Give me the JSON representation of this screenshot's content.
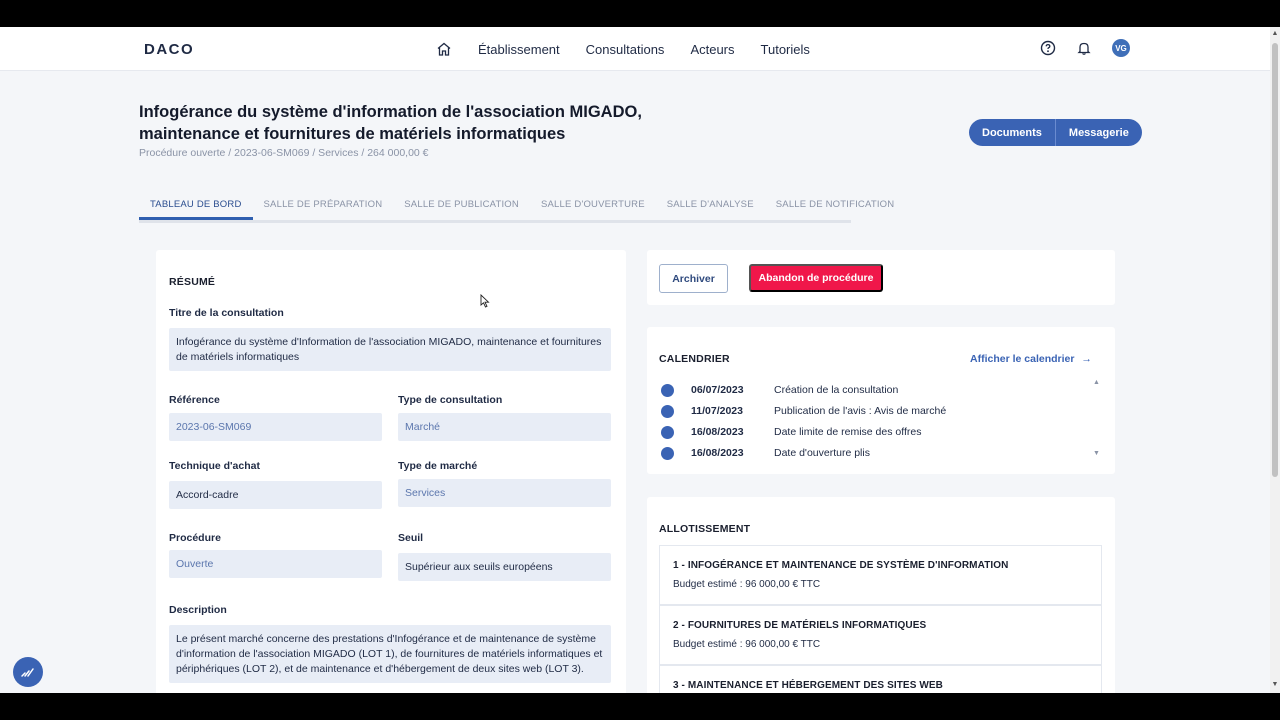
{
  "header": {
    "logo": "DACO",
    "nav": [
      "Établissement",
      "Consultations",
      "Acteurs",
      "Tutoriels"
    ],
    "avatar_initials": "VG"
  },
  "page": {
    "title": "Infogérance du système d'information de l'association MIGADO, maintenance et fournitures de matériels informatiques",
    "subtitle": "Procédure ouverte / 2023-06-SM069 / Services / 264 000,00 €",
    "documents_label": "Documents",
    "messagerie_label": "Messagerie"
  },
  "tabs": [
    "TABLEAU DE BORD",
    "SALLE DE PRÉPARATION",
    "SALLE DE PUBLICATION",
    "SALLE D'OUVERTURE",
    "SALLE D'ANALYSE",
    "SALLE DE NOTIFICATION"
  ],
  "resume": {
    "section_title": "RÉSUMÉ",
    "titre_label": "Titre de la consultation",
    "titre_value": "Infogérance du système d'Information de l'association MIGADO, maintenance et fournitures de matériels informatiques",
    "reference_label": "Référence",
    "reference_value": "2023-06-SM069",
    "type_consultation_label": "Type de consultation",
    "type_consultation_value": "Marché",
    "technique_label": "Technique d'achat",
    "technique_value": "Accord-cadre",
    "type_marche_label": "Type de marché",
    "type_marche_value": "Services",
    "procedure_label": "Procédure",
    "procedure_value": "Ouverte",
    "seuil_label": "Seuil",
    "seuil_value": "Supérieur aux seuils européens",
    "description_label": "Description",
    "description_value": "Le présent marché concerne des prestations d'Infogérance et de maintenance de système d'information de l'association MIGADO (LOT 1), de fournitures de matériels informatiques et périphériques (LOT 2), et de maintenance et d'hébergement de deux sites web (LOT 3)."
  },
  "actions": {
    "archiver_label": "Archiver",
    "abandon_label": "Abandon de procédure"
  },
  "calendrier": {
    "section_title": "CALENDRIER",
    "link_label": "Afficher le calendrier",
    "events": [
      {
        "date": "06/07/2023",
        "label": "Création de la consultation"
      },
      {
        "date": "11/07/2023",
        "label": "Publication de l'avis : Avis de marché"
      },
      {
        "date": "16/08/2023",
        "label": "Date limite de remise des offres"
      },
      {
        "date": "16/08/2023",
        "label": "Date d'ouverture plis"
      }
    ]
  },
  "allotissement": {
    "section_title": "ALLOTISSEMENT",
    "lots": [
      {
        "title": "1 - INFOGÉRANCE ET MAINTENANCE DE SYSTÈME D'INFORMATION",
        "budget": "Budget estimé : 96 000,00 € TTC"
      },
      {
        "title": "2 - FOURNITURES DE MATÉRIELS INFORMATIQUES",
        "budget": "Budget estimé : 96 000,00 € TTC"
      },
      {
        "title": "3 - MAINTENANCE ET HÉBERGEMENT DES SITES WEB",
        "budget": ""
      }
    ]
  },
  "colors": {
    "accent": "#3a63b4",
    "danger": "#f0174a",
    "field_bg": "#e8edf6"
  }
}
